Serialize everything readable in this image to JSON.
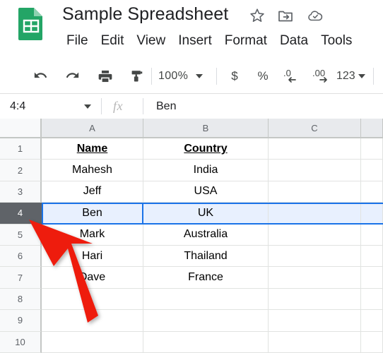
{
  "app": {
    "logo_icon": "google-sheets-logo",
    "document_title": "Sample Spreadsheet"
  },
  "header": {
    "icons": [
      {
        "name": "star-icon",
        "label": "Star"
      },
      {
        "name": "move-to-folder-icon",
        "label": "Move"
      },
      {
        "name": "cloud-saved-icon",
        "label": "Saved to Drive"
      }
    ],
    "menus": [
      {
        "label": "File"
      },
      {
        "label": "Edit"
      },
      {
        "label": "View"
      },
      {
        "label": "Insert"
      },
      {
        "label": "Format"
      },
      {
        "label": "Data"
      },
      {
        "label": "Tools"
      }
    ]
  },
  "toolbar": {
    "undo_icon": "undo-icon",
    "redo_icon": "redo-icon",
    "print_icon": "print-icon",
    "paint_format_icon": "paint-format-icon",
    "zoom_value": "100%",
    "currency_label": "$",
    "percent_label": "%",
    "decrease_decimal_label": ".0",
    "increase_decimal_label": ".00",
    "more_formats_label": "123"
  },
  "formula_bar": {
    "name_box_value": "4:4",
    "fx_label": "fx",
    "formula_value": "Ben"
  },
  "grid": {
    "column_headers": [
      "A",
      "B",
      "C"
    ],
    "row_headers": [
      "1",
      "2",
      "3",
      "4",
      "5",
      "6",
      "7",
      "8",
      "9",
      "10"
    ],
    "selected_row": "4",
    "active_cell_value": "Ben",
    "selection_color": "#1a73e8",
    "selection_fill": "#e8f0fe",
    "row_header_selected_color": "#5f6368",
    "rows": [
      {
        "row": "1",
        "A": "Name",
        "B": "Country",
        "C": "",
        "header": true,
        "selected": false
      },
      {
        "row": "2",
        "A": "Mahesh",
        "B": "India",
        "C": "",
        "header": false,
        "selected": false
      },
      {
        "row": "3",
        "A": "Jeff",
        "B": "USA",
        "C": "",
        "header": false,
        "selected": false
      },
      {
        "row": "4",
        "A": "Ben",
        "B": "UK",
        "C": "",
        "header": false,
        "selected": true
      },
      {
        "row": "5",
        "A": "Mark",
        "B": "Australia",
        "C": "",
        "header": false,
        "selected": false
      },
      {
        "row": "6",
        "A": "Hari",
        "B": "Thailand",
        "C": "",
        "header": false,
        "selected": false
      },
      {
        "row": "7",
        "A": "Dave",
        "B": "France",
        "C": "",
        "header": false,
        "selected": false
      },
      {
        "row": "8",
        "A": "",
        "B": "",
        "C": "",
        "header": false,
        "selected": false
      },
      {
        "row": "9",
        "A": "",
        "B": "",
        "C": "",
        "header": false,
        "selected": false
      },
      {
        "row": "10",
        "A": "",
        "B": "",
        "C": "",
        "header": false,
        "selected": false
      }
    ]
  },
  "annotation": {
    "arrow_icon": "red-arrow-pointer",
    "arrow_color": "#ee1c11"
  }
}
